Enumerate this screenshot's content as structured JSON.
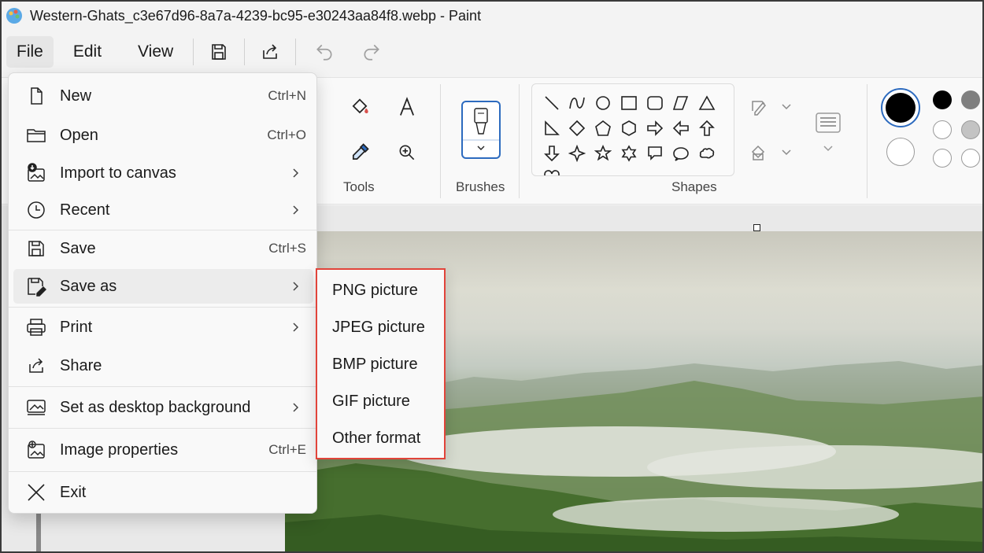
{
  "window": {
    "title": "Western-Ghats_c3e67d96-8a7a-4239-bc95-e30243aa84f8.webp - Paint"
  },
  "menubar": {
    "file": "File",
    "edit": "Edit",
    "view": "View"
  },
  "ribbon": {
    "tools_label": "Tools",
    "brushes_label": "Brushes",
    "shapes_label": "Shapes"
  },
  "colors": {
    "primary": "#000000",
    "secondary": "#ffffff",
    "accent": "#2d6bbf",
    "highlight_border": "#e1443a"
  },
  "file_menu": {
    "items": [
      {
        "label": "New",
        "shortcut": "Ctrl+N",
        "icon": "new-page-icon"
      },
      {
        "label": "Open",
        "shortcut": "Ctrl+O",
        "icon": "folder-icon"
      },
      {
        "label": "Import to canvas",
        "icon": "import-image-icon",
        "submenu": true
      },
      {
        "label": "Recent",
        "icon": "clock-icon",
        "submenu": true
      },
      {
        "label": "Save",
        "shortcut": "Ctrl+S",
        "icon": "save-icon"
      },
      {
        "label": "Save as",
        "icon": "save-as-icon",
        "submenu": true,
        "highlighted": true
      },
      {
        "label": "Print",
        "icon": "printer-icon",
        "submenu": true
      },
      {
        "label": "Share",
        "icon": "share-icon"
      },
      {
        "label": "Set as desktop background",
        "icon": "desktop-background-icon",
        "submenu": true
      },
      {
        "label": "Image properties",
        "shortcut": "Ctrl+E",
        "icon": "image-properties-icon"
      },
      {
        "label": "Exit",
        "icon": "close-icon"
      }
    ]
  },
  "save_as_submenu": {
    "items": [
      "PNG picture",
      "JPEG picture",
      "BMP picture",
      "GIF picture",
      "Other format"
    ]
  }
}
